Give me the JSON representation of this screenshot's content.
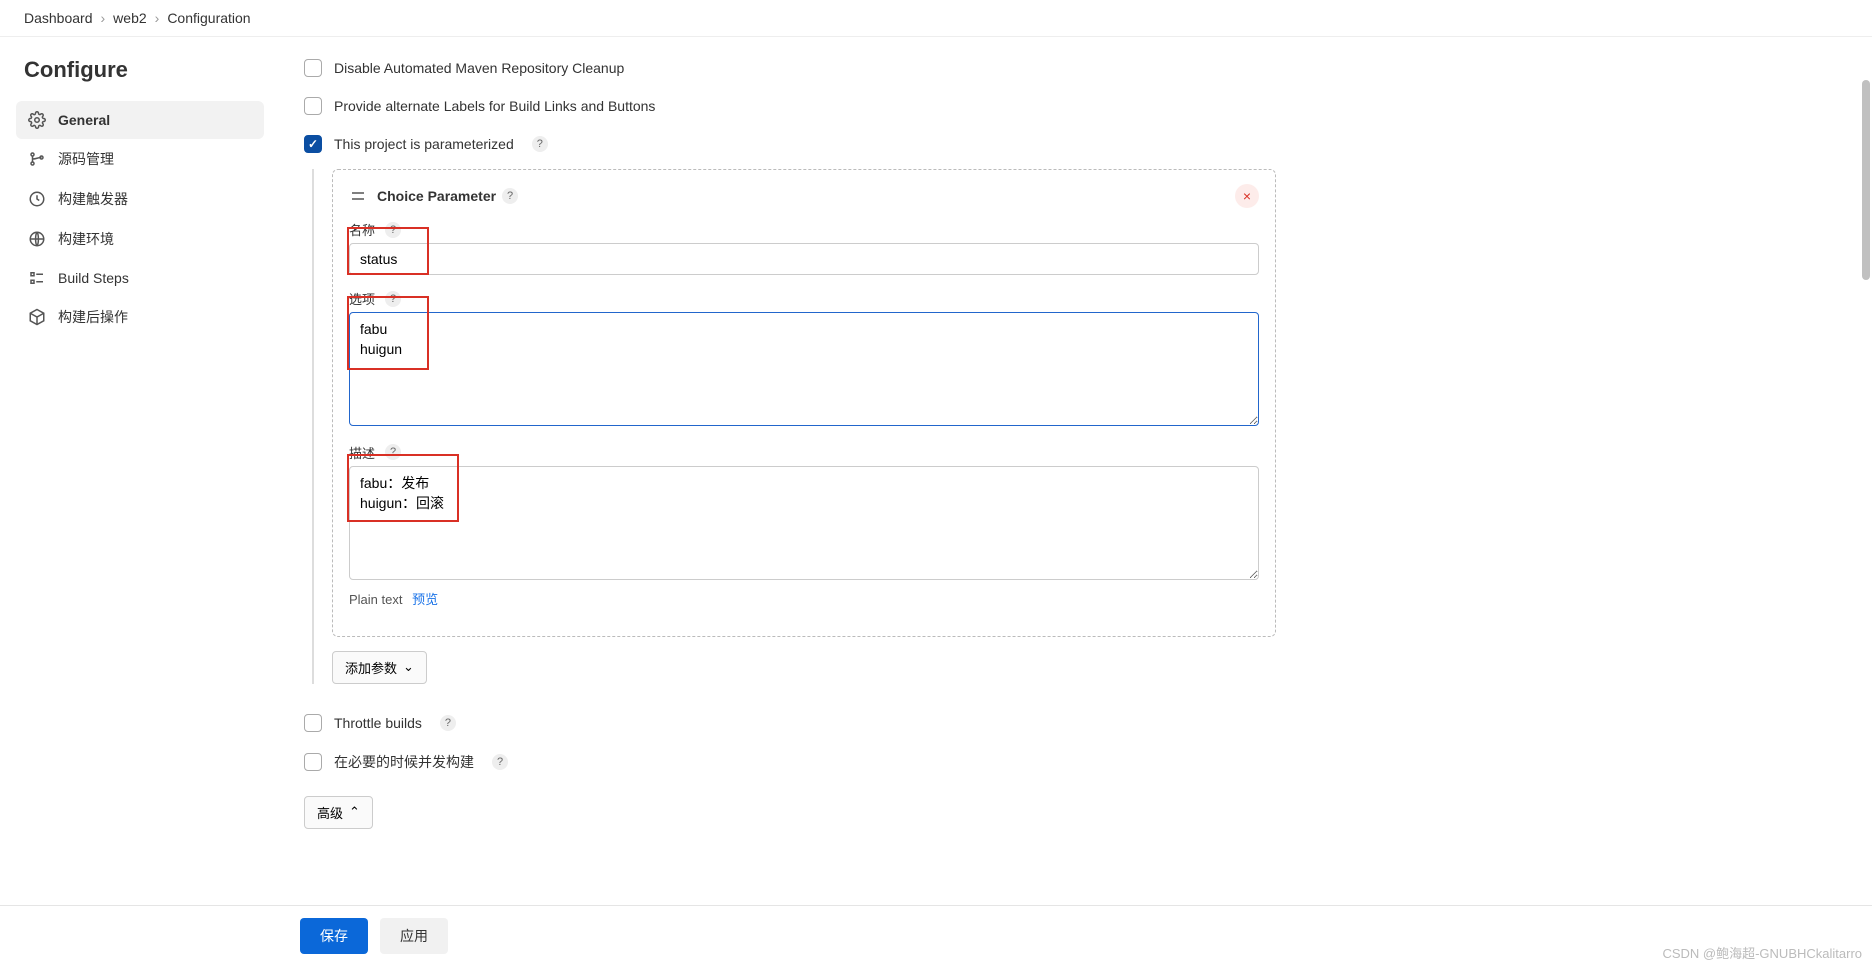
{
  "breadcrumb": {
    "items": [
      "Dashboard",
      "web2",
      "Configuration"
    ]
  },
  "page_title": "Configure",
  "sidebar": {
    "items": [
      {
        "label": "General",
        "active": true
      },
      {
        "label": "源码管理",
        "active": false
      },
      {
        "label": "构建触发器",
        "active": false
      },
      {
        "label": "构建环境",
        "active": false
      },
      {
        "label": "Build Steps",
        "active": false
      },
      {
        "label": "构建后操作",
        "active": false
      }
    ]
  },
  "options": {
    "disable_cleanup": "Disable Automated Maven Repository Cleanup",
    "alt_labels": "Provide alternate Labels for Build Links and Buttons",
    "parameterized": "This project is parameterized",
    "throttle": "Throttle builds",
    "concurrent": "在必要的时候并发构建"
  },
  "choice_param": {
    "title": "Choice Parameter",
    "name_label": "名称",
    "name_value": "status",
    "choices_label": "选项",
    "choices_value": "fabu\nhuigun",
    "desc_label": "描述",
    "desc_value": "fabu：发布\nhuigun：回滚",
    "format_label": "Plain text",
    "preview_label": "预览"
  },
  "buttons": {
    "add_param": "添加参数",
    "advanced": "高级",
    "save": "保存",
    "apply": "应用"
  },
  "watermark": "CSDN @鲍海超-GNUBHCkalitarro"
}
